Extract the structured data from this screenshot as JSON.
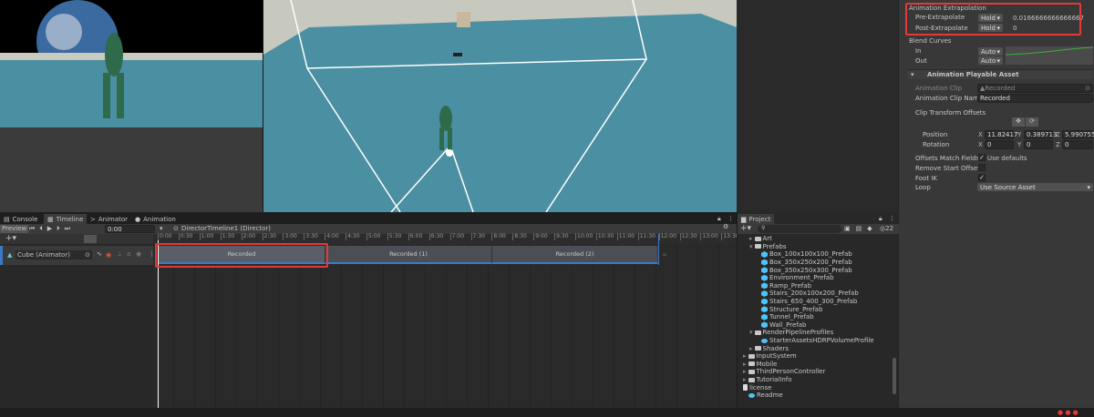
{
  "inspector": {
    "extrapolation_header": "Animation Extrapolation",
    "pre_label": "Pre-Extrapolate",
    "pre_mode": "Hold",
    "pre_value": "0.0166666666666667",
    "post_label": "Post-Extrapolate",
    "post_mode": "Hold",
    "post_value": "0",
    "blend_header": "Blend Curves",
    "in_label": "In",
    "in_mode": "Auto",
    "out_label": "Out",
    "out_mode": "Auto",
    "section_title": "Animation Playable Asset",
    "clip_label": "Animation Clip",
    "clip_value": "Recorded",
    "clip_name_label": "Animation Clip Name",
    "clip_name_value": "Recorded",
    "offsets_label": "Clip Transform Offsets",
    "position_label": "Position",
    "pos_x": "11.82417",
    "pos_y": "0.389713",
    "pos_z": "5.990755",
    "rotation_label": "Rotation",
    "rot_x": "0",
    "rot_y": "0",
    "rot_z": "0",
    "x": "X",
    "y": "Y",
    "z": "Z",
    "match_label": "Offsets Match Fields",
    "match_value": "Use defaults",
    "remove_label": "Remove Start Offset",
    "footik_label": "Foot IK",
    "loop_label": "Loop",
    "loop_value": "Use Source Asset"
  },
  "timeline": {
    "tabs": [
      "Console",
      "Timeline",
      "Animator",
      "Animation"
    ],
    "preview": "Preview",
    "time": "0:00",
    "director": "DirectorTimeline1 (Director)",
    "track": "Cube (Animator)",
    "ticks": [
      "0:00",
      "0:30",
      "1:00",
      "1:30",
      "2:00",
      "2:30",
      "3:00",
      "3:30",
      "4:00",
      "4:30",
      "5:00",
      "5:30",
      "6:00",
      "6:30",
      "7:00",
      "7:30",
      "8:00",
      "8:30",
      "9:00",
      "9:30",
      "10:00",
      "10:30",
      "11:00",
      "11:30",
      "12:00",
      "12:30",
      "13:00",
      "13:30"
    ],
    "clips": [
      "Recorded",
      "Recorded (1)",
      "Recorded (2)"
    ],
    "infinity": "∞"
  },
  "project": {
    "title": "Project",
    "count": "22",
    "items": [
      {
        "label": "Art",
        "type": "folder",
        "depth": 1
      },
      {
        "label": "Prefabs",
        "type": "folder-open",
        "depth": 1
      },
      {
        "label": "Box_100x100x100_Prefab",
        "type": "prefab",
        "depth": 2
      },
      {
        "label": "Box_350x250x200_Prefab",
        "type": "prefab",
        "depth": 2
      },
      {
        "label": "Box_350x250x300_Prefab",
        "type": "prefab",
        "depth": 2
      },
      {
        "label": "Environment_Prefab",
        "type": "prefab",
        "depth": 2
      },
      {
        "label": "Ramp_Prefab",
        "type": "prefab",
        "depth": 2
      },
      {
        "label": "Stairs_200x100x200_Prefab",
        "type": "prefab",
        "depth": 2
      },
      {
        "label": "Stairs_650_400_300_Prefab",
        "type": "prefab",
        "depth": 2
      },
      {
        "label": "Structure_Prefab",
        "type": "prefab",
        "depth": 2
      },
      {
        "label": "Tunnel_Prefab",
        "type": "prefab",
        "depth": 2
      },
      {
        "label": "Wall_Prefab",
        "type": "prefab",
        "depth": 2
      },
      {
        "label": "RenderPipelineProfiles",
        "type": "folder-open",
        "depth": 1
      },
      {
        "label": "StarterAssetsHDRPVolumeProfile",
        "type": "asset",
        "depth": 2
      },
      {
        "label": "Shaders",
        "type": "folder",
        "depth": 1
      },
      {
        "label": "InputSystem",
        "type": "folder",
        "depth": 0
      },
      {
        "label": "Mobile",
        "type": "folder",
        "depth": 0
      },
      {
        "label": "ThirdPersonController",
        "type": "folder",
        "depth": 0
      },
      {
        "label": "TutorialInfo",
        "type": "folder",
        "depth": 0
      },
      {
        "label": "license",
        "type": "file",
        "depth": 0
      },
      {
        "label": "Readme",
        "type": "asset",
        "depth": 0
      }
    ]
  },
  "colors": {
    "accent": "#3c7bc4",
    "highlight": "#e53935",
    "floor": "#4b8fa3"
  }
}
